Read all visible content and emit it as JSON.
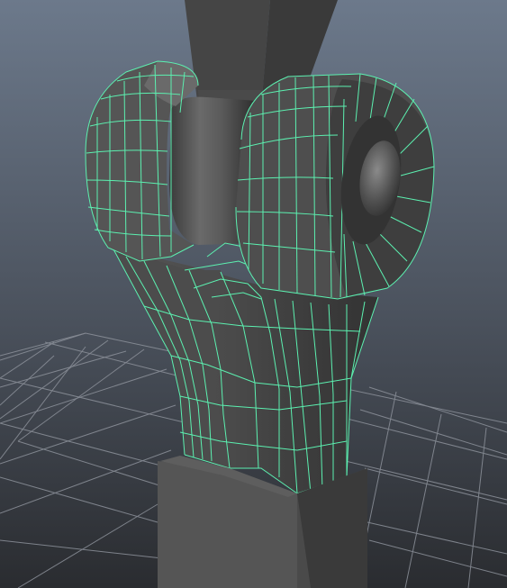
{
  "viewport": {
    "background_top": "#6b7789",
    "background_bottom": "#2b2d31",
    "grid_color": "#8c919a",
    "wireframe_color": "#5cf0b0",
    "shade_light": "#7a7a7a",
    "shade_mid": "#5a5a5a",
    "shade_dark": "#3a3a3a",
    "shade_darkest": "#2a2a2a"
  },
  "scene": {
    "objects": [
      "upper-arm",
      "left-knuckle",
      "right-knuckle",
      "center-pin",
      "lower-link",
      "base-block",
      "ground-grid"
    ],
    "selected_object": "lower-link",
    "display_mode": "wireframe-on-shaded"
  }
}
